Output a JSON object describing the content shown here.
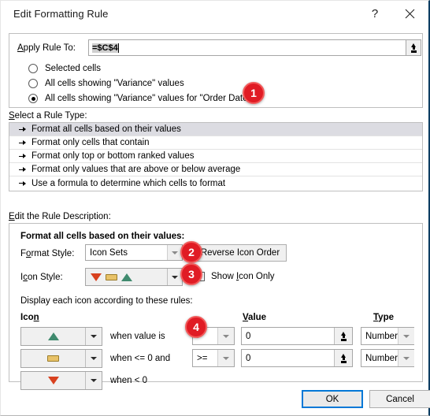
{
  "window": {
    "title": "Edit Formatting Rule",
    "help_icon": "?",
    "close_icon": "close-icon"
  },
  "apply_rule": {
    "label": "Apply Rule To:",
    "input_value": "=$C$4",
    "collapse_icon": "collapse-dialog-icon",
    "options": [
      {
        "label": "Selected cells",
        "checked": false
      },
      {
        "label": "All cells showing \"Variance\" values",
        "checked": false
      },
      {
        "label": "All cells showing \"Variance\" values for \"Order Date\"",
        "checked": true
      }
    ]
  },
  "rule_type": {
    "label": "Select a Rule Type:",
    "items": [
      {
        "label": "Format all cells based on their values",
        "selected": true
      },
      {
        "label": "Format only cells that contain",
        "selected": false
      },
      {
        "label": "Format only top or bottom ranked values",
        "selected": false
      },
      {
        "label": "Format only values that are above or below average",
        "selected": false
      },
      {
        "label": "Use a formula to determine which cells to format",
        "selected": false
      }
    ]
  },
  "rule_description": {
    "label": "Edit the Rule Description:",
    "heading": "Format all cells based on their values:",
    "format_style_label": "Format Style:",
    "format_style_value": "Icon Sets",
    "icon_style_label": "Icon Style:",
    "reverse_button": "Reverse Icon Order",
    "show_icon_only": "Show Icon Only",
    "show_icon_only_checked": false,
    "display_rules_label": "Display each icon according to these rules:",
    "headers": {
      "icon": "Icon",
      "value": "Value",
      "type": "Type"
    },
    "rows": [
      {
        "icon": "green-up-triangle-icon",
        "condition": "when value is",
        "operator": ">",
        "value": "0",
        "type": "Number",
        "has_inputs": true
      },
      {
        "icon": "yellow-bar-icon",
        "condition": "when <= 0 and",
        "operator": ">=",
        "value": "0",
        "type": "Number",
        "has_inputs": true
      },
      {
        "icon": "red-down-triangle-icon",
        "condition": "when < 0",
        "operator": "",
        "value": "",
        "type": "",
        "has_inputs": false
      }
    ]
  },
  "footer": {
    "ok": "OK",
    "cancel": "Cancel"
  },
  "callouts": [
    {
      "number": "1"
    },
    {
      "number": "2"
    },
    {
      "number": "3"
    },
    {
      "number": "4"
    }
  ],
  "colors": {
    "badge": "#e01b24",
    "focus": "#0078d7",
    "green": "#3f8a6e",
    "yellow": "#e8c268",
    "red": "#d8411f",
    "selection": "#dcdce2"
  }
}
